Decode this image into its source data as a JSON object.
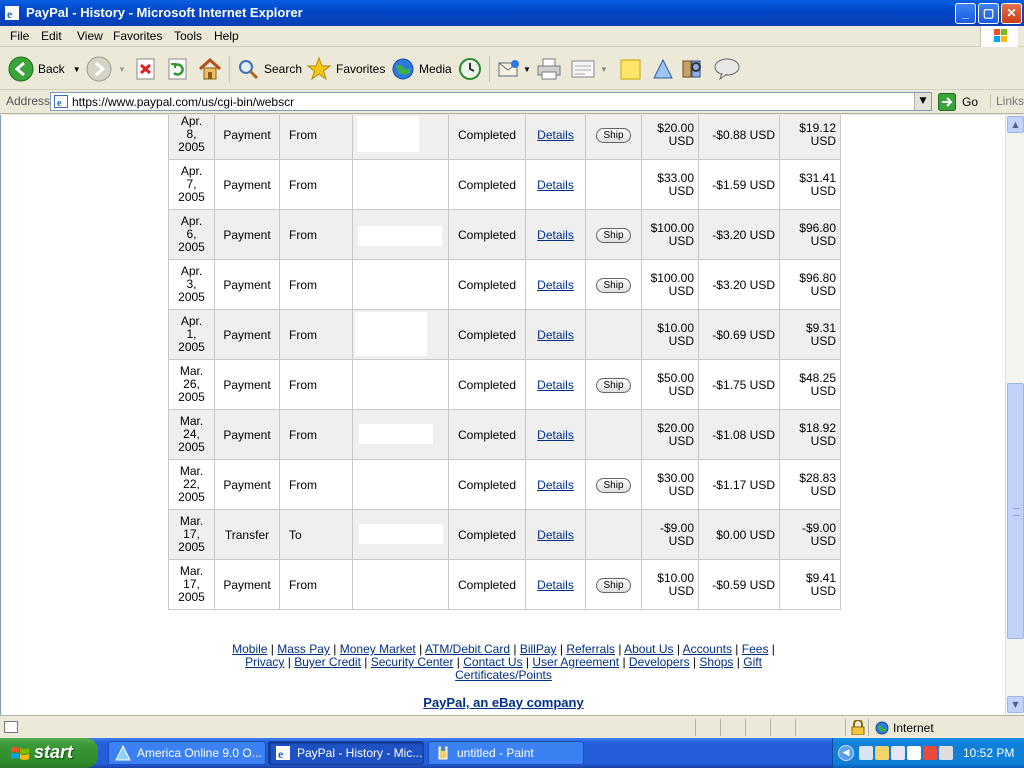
{
  "window": {
    "title": "PayPal - History - Microsoft Internet Explorer",
    "min": "_",
    "max": "▢",
    "close": "✕"
  },
  "menu": [
    "File",
    "Edit",
    "View",
    "Favorites",
    "Tools",
    "Help"
  ],
  "toolbar": {
    "back": "Back",
    "search": "Search",
    "favorites": "Favorites",
    "media": "Media"
  },
  "address": {
    "label": "Address",
    "url": "https://www.paypal.com/us/cgi-bin/webscr",
    "go": "Go",
    "links": "Links"
  },
  "history": {
    "rows": [
      {
        "date": [
          "Apr.",
          "8,",
          "2005"
        ],
        "type": "Payment",
        "direction": "From",
        "status": "Completed",
        "details": "Details",
        "ship": "Ship",
        "amount": [
          "$20.00",
          "USD"
        ],
        "fee": "-$0.88 USD",
        "net": [
          "$19.12",
          "USD"
        ]
      },
      {
        "date": [
          "Apr.",
          "7,",
          "2005"
        ],
        "type": "Payment",
        "direction": "From",
        "status": "Completed",
        "details": "Details",
        "ship": "",
        "amount": [
          "$33.00",
          "USD"
        ],
        "fee": "-$1.59 USD",
        "net": [
          "$31.41",
          "USD"
        ]
      },
      {
        "date": [
          "Apr.",
          "6,",
          "2005"
        ],
        "type": "Payment",
        "direction": "From",
        "status": "Completed",
        "details": "Details",
        "ship": "Ship",
        "amount": [
          "$100.00",
          "USD"
        ],
        "fee": "-$3.20 USD",
        "net": [
          "$96.80",
          "USD"
        ]
      },
      {
        "date": [
          "Apr.",
          "3,",
          "2005"
        ],
        "type": "Payment",
        "direction": "From",
        "status": "Completed",
        "details": "Details",
        "ship": "Ship",
        "amount": [
          "$100.00",
          "USD"
        ],
        "fee": "-$3.20 USD",
        "net": [
          "$96.80",
          "USD"
        ]
      },
      {
        "date": [
          "Apr.",
          "1,",
          "2005"
        ],
        "type": "Payment",
        "direction": "From",
        "status": "Completed",
        "details": "Details",
        "ship": "",
        "amount": [
          "$10.00",
          "USD"
        ],
        "fee": "-$0.69 USD",
        "net": [
          "$9.31",
          "USD"
        ]
      },
      {
        "date": [
          "Mar.",
          "26,",
          "2005"
        ],
        "type": "Payment",
        "direction": "From",
        "status": "Completed",
        "details": "Details",
        "ship": "Ship",
        "amount": [
          "$50.00",
          "USD"
        ],
        "fee": "-$1.75 USD",
        "net": [
          "$48.25",
          "USD"
        ]
      },
      {
        "date": [
          "Mar.",
          "24,",
          "2005"
        ],
        "type": "Payment",
        "direction": "From",
        "status": "Completed",
        "details": "Details",
        "ship": "",
        "amount": [
          "$20.00",
          "USD"
        ],
        "fee": "-$1.08 USD",
        "net": [
          "$18.92",
          "USD"
        ]
      },
      {
        "date": [
          "Mar.",
          "22,",
          "2005"
        ],
        "type": "Payment",
        "direction": "From",
        "status": "Completed",
        "details": "Details",
        "ship": "Ship",
        "amount": [
          "$30.00",
          "USD"
        ],
        "fee": "-$1.17 USD",
        "net": [
          "$28.83",
          "USD"
        ]
      },
      {
        "date": [
          "Mar.",
          "17,",
          "2005"
        ],
        "type": "Transfer",
        "direction": "To",
        "status": "Completed",
        "details": "Details",
        "ship": "",
        "amount": [
          "-$9.00",
          "USD"
        ],
        "fee": "$0.00 USD",
        "net": [
          "-$9.00",
          "USD"
        ]
      },
      {
        "date": [
          "Mar.",
          "17,",
          "2005"
        ],
        "type": "Payment",
        "direction": "From",
        "status": "Completed",
        "details": "Details",
        "ship": "Ship",
        "amount": [
          "$10.00",
          "USD"
        ],
        "fee": "-$0.59 USD",
        "net": [
          "$9.41",
          "USD"
        ]
      }
    ]
  },
  "footer": {
    "links_row1": [
      "Mobile",
      "Mass Pay",
      "Money Market",
      "ATM/Debit Card",
      "BillPay",
      "Referrals",
      "About Us",
      "Accounts",
      "Fees"
    ],
    "links_row2": [
      "Privacy",
      "Buyer Credit",
      "Security Center",
      "Contact Us",
      "User Agreement",
      "Developers",
      "Shops",
      "Gift"
    ],
    "links_row3": [
      "Certificates/Points"
    ],
    "tagline": "PayPal, an eBay company"
  },
  "status": {
    "zone": "Internet"
  },
  "taskbar": {
    "start": "start",
    "tasks": [
      "America Online 9.0 O...",
      "PayPal - History - Mic...",
      "untitled - Paint"
    ],
    "clock": "10:52 PM"
  },
  "colors": {
    "link": "#003087",
    "row_shade": "#efefef",
    "titlebar": "#0a5fe0",
    "taskbar": "#245edb",
    "start": "#3c9a3a"
  }
}
